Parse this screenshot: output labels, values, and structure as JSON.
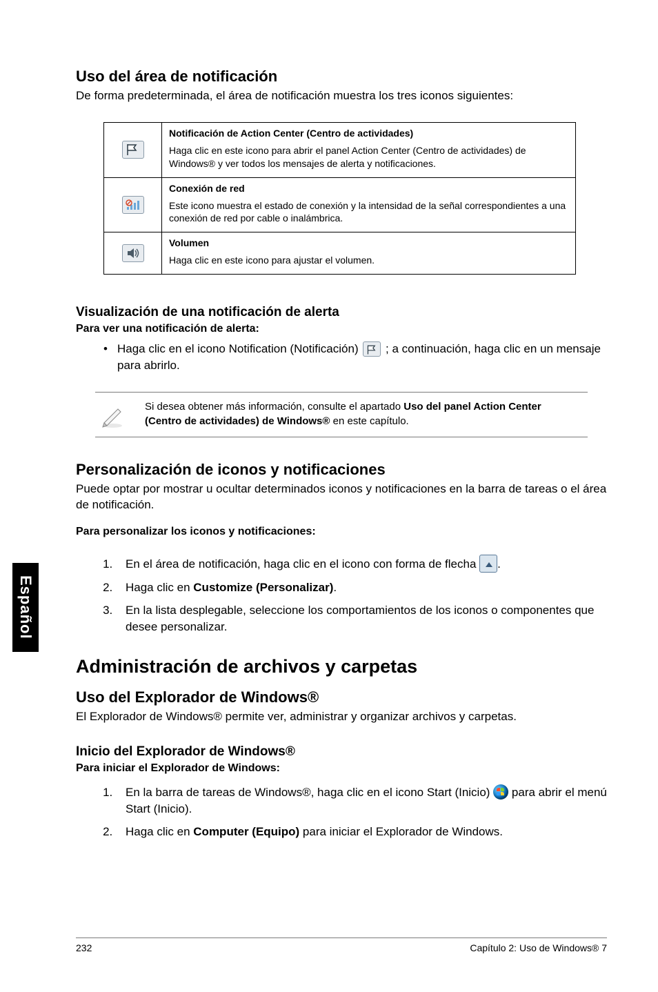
{
  "side_tab": "Español",
  "section1": {
    "heading": "Uso del área de notificación",
    "intro": "De forma predeterminada, el área de notificación muestra los tres iconos siguientes:"
  },
  "table": {
    "rows": [
      {
        "icon": "flag-icon",
        "title": "Notificación de Action Center (Centro de actividades)",
        "desc": "Haga clic en este icono para abrir el panel Action Center (Centro de actividades) de Windows® y ver todos los mensajes de alerta y notificaciones."
      },
      {
        "icon": "network-icon",
        "title": "Conexión de red",
        "desc": "Este icono muestra el estado de conexión y la intensidad de la señal correspondientes a una conexión de red por cable o inalámbrica."
      },
      {
        "icon": "volume-icon",
        "title": "Volumen",
        "desc": "Haga clic en este icono para ajustar el volumen."
      }
    ]
  },
  "alert": {
    "heading": "Visualización de una notificación de alerta",
    "sub": "Para ver una notificación de alerta:",
    "bullet_pre": "Haga clic en el icono Notification (Notificación) ",
    "bullet_post": " ; a continuación, haga clic en un mensaje para abrirlo."
  },
  "note": {
    "pre": "Si desea obtener más información, consulte el apartado ",
    "bold": "Uso del panel Action Center (Centro de actividades) de Windows®",
    "post": " en este capítulo."
  },
  "personal": {
    "heading": "Personalización de iconos y notificaciones",
    "intro": "Puede optar por mostrar u ocultar determinados iconos y notificaciones en la barra de tareas o el área de notificación.",
    "sub": "Para personalizar los iconos y notificaciones:",
    "steps": [
      {
        "pre": "En el área de notificación, haga clic en el icono con forma de flecha ",
        "icon": "arrow-up-badge-icon",
        "post": "."
      },
      {
        "pre": "Haga clic en ",
        "bold": "Customize (Personalizar)",
        "post": "."
      },
      {
        "pre": "En la lista desplegable, seleccione los comportamientos de los iconos o componentes que desee personalizar."
      }
    ]
  },
  "major": "Administración de archivos y carpetas",
  "explorer": {
    "heading": "Uso del Explorador de Windows®",
    "intro": "El Explorador de Windows® permite ver, administrar y organizar archivos y carpetas.",
    "sub_heading": "Inicio del Explorador de Windows®",
    "sub": "Para iniciar el Explorador de Windows:",
    "steps": [
      {
        "pre": "En la barra de tareas de Windows®, haga clic en el icono Start (Inicio) ",
        "icon": "start-orb-icon",
        "post": " para abrir el menú Start (Inicio)."
      },
      {
        "pre": "Haga clic en ",
        "bold": "Computer (Equipo)",
        "post": " para iniciar el Explorador de Windows."
      }
    ]
  },
  "footer": {
    "page": "232",
    "chapter": "Capítulo 2: Uso de Windows® 7"
  }
}
